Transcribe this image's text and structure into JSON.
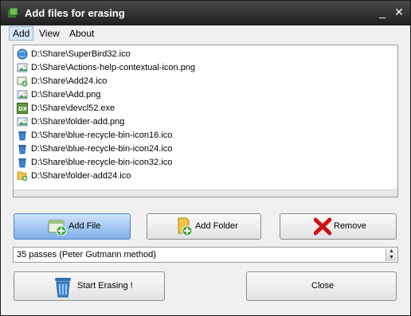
{
  "window": {
    "title": "Add files for erasing",
    "minimize_glyph": "_",
    "close_glyph": "✕"
  },
  "menu": [
    "Add",
    "View",
    "About"
  ],
  "files": [
    {
      "path": "D:\\Share\\SuperBird32.ico",
      "icon": "globe-icon"
    },
    {
      "path": "D:\\Share\\Actions-help-contextual-icon.png",
      "icon": "image-file-icon"
    },
    {
      "path": "D:\\Share\\Add24.ico",
      "icon": "add-image-icon"
    },
    {
      "path": "D:\\Share\\Add.png",
      "icon": "image-file-icon"
    },
    {
      "path": "D:\\Share\\devcl52.exe",
      "icon": "dx-exe-icon"
    },
    {
      "path": "D:\\Share\\folder-add.png",
      "icon": "image-file-icon"
    },
    {
      "path": "D:\\Share\\blue-recycle-bin-icon16.ico",
      "icon": "recycle-bin-icon"
    },
    {
      "path": "D:\\Share\\blue-recycle-bin-icon24.ico",
      "icon": "recycle-bin-icon"
    },
    {
      "path": "D:\\Share\\blue-recycle-bin-icon32.ico",
      "icon": "recycle-bin-icon"
    },
    {
      "path": "D:\\Share\\folder-add24.ico",
      "icon": "folder-add-icon"
    }
  ],
  "buttons": {
    "add_file": "Add File",
    "add_folder": "Add Folder",
    "remove": "Remove",
    "start": "Start Erasing !",
    "close": "Close"
  },
  "method": {
    "selected": "35 passes (Peter Gutmann method)"
  },
  "colors": {
    "titlebar": "#2a2a2a",
    "primary_button": "#7fb0ea",
    "remove_x": "#cc1010"
  }
}
